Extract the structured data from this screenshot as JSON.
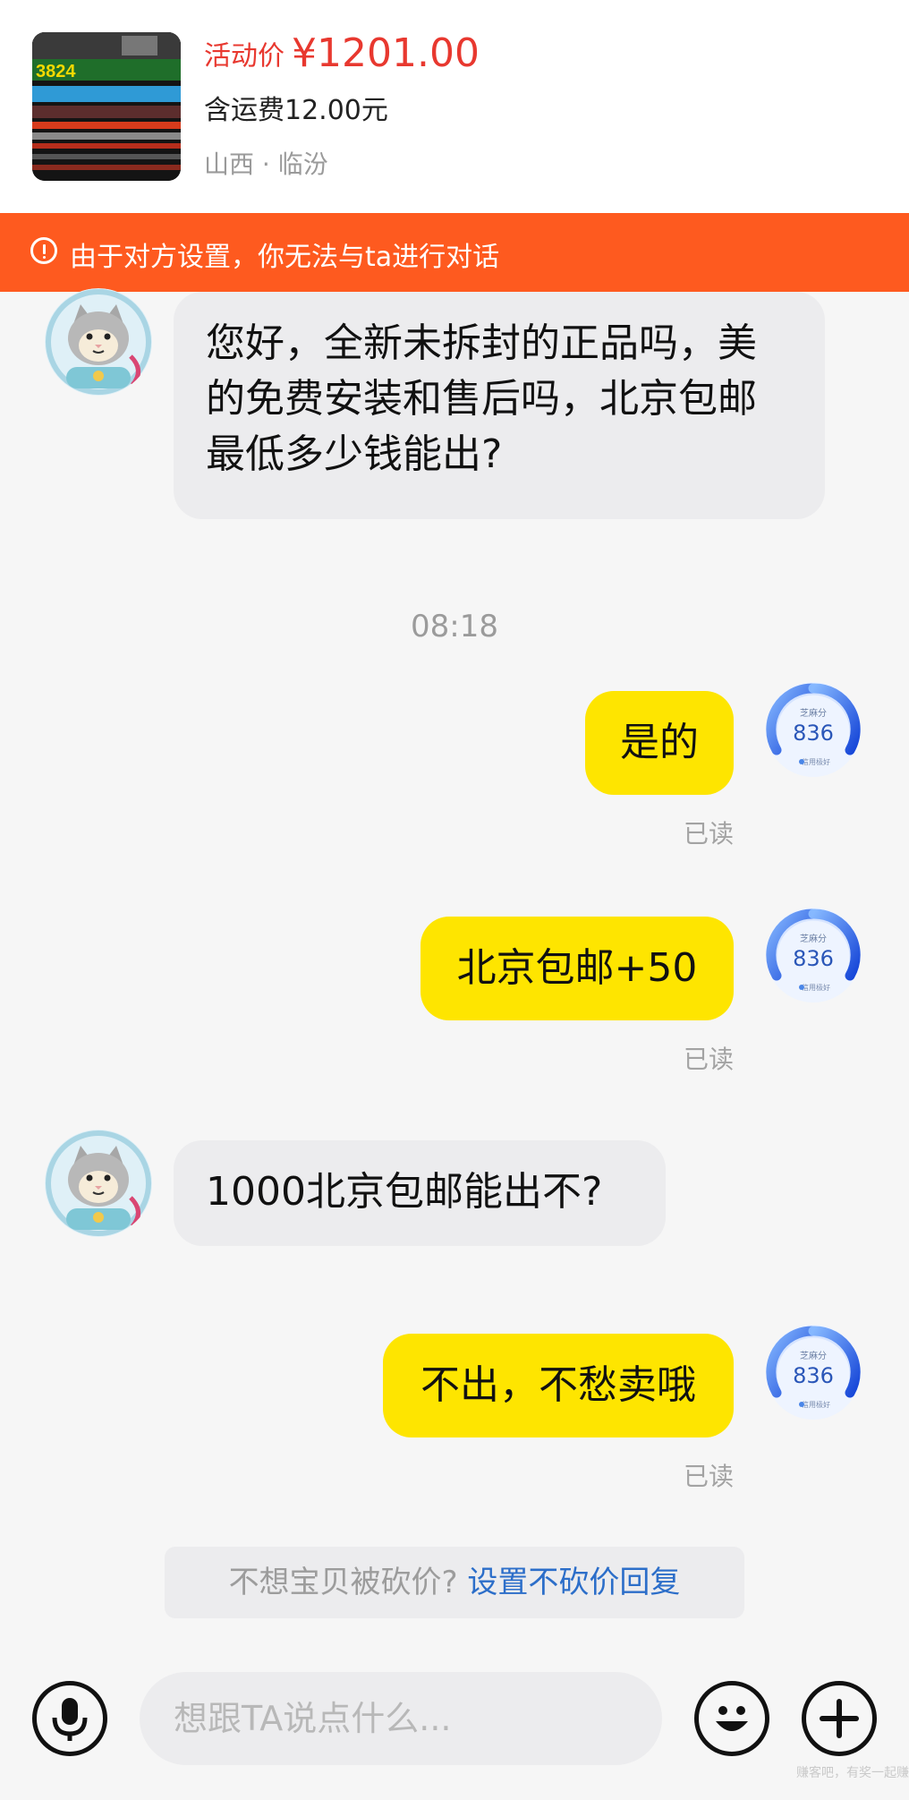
{
  "product": {
    "price_label": "活动价",
    "price_value": "¥1201.00",
    "shipping": "含运费12.00元",
    "location": "山西 · 临汾",
    "thumb_text": "3824"
  },
  "banner": {
    "text": "由于对方设置，你无法与ta进行对话",
    "icon": "alert-circle-icon"
  },
  "messages": [
    {
      "side": "incoming",
      "lines": [
        "您好，全新未拆封的正品吗，美",
        "的免费安装和售后吗，北京包邮",
        "最低多少钱能出?"
      ]
    },
    {
      "side": "outgoing",
      "text": "是的",
      "status": "已读"
    },
    {
      "side": "outgoing",
      "text": "北京包邮+50",
      "status": "已读"
    },
    {
      "side": "incoming",
      "lines": [
        "1000北京包邮能出不?"
      ]
    },
    {
      "side": "outgoing",
      "text": "不出，不愁卖哦",
      "status": "已读"
    }
  ],
  "timestamp": "08:18",
  "credit_badge": {
    "label": "芝麻分",
    "score": "836",
    "sub": "信用极好"
  },
  "hint": {
    "text": "不想宝贝被砍价?",
    "link": "设置不砍价回复"
  },
  "input": {
    "placeholder": "想跟TA说点什么..."
  },
  "icons": [
    "microphone-icon",
    "emoji-icon",
    "plus-icon"
  ],
  "watermark": "赚客吧，有奖一起赚！",
  "colors": {
    "accent": "#fe5a1f",
    "price": "#e8382f",
    "bubble_out": "#fee500",
    "link": "#2c6ec9"
  }
}
